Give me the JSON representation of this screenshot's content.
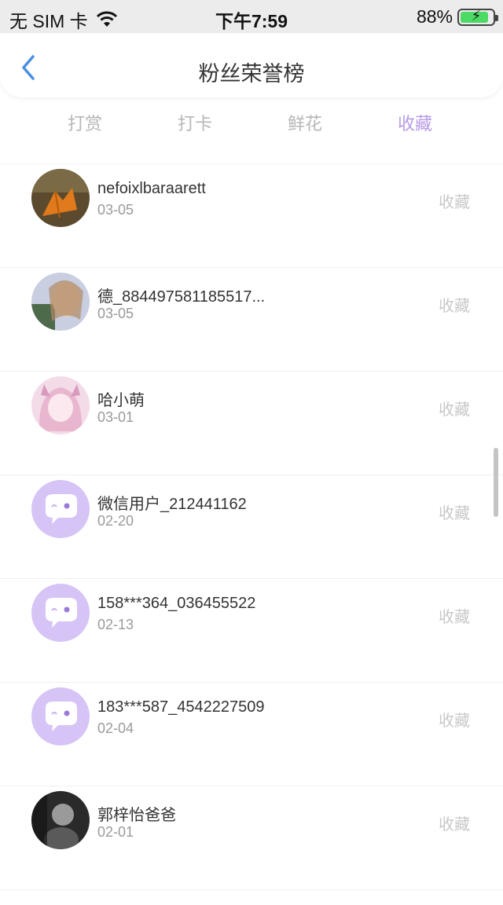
{
  "status_bar": {
    "carrier": "无 SIM 卡",
    "time": "下午7:59",
    "battery_percent": "88%",
    "battery_level": 0.88
  },
  "nav": {
    "title": "粉丝荣誉榜"
  },
  "tabs": [
    {
      "label": "打赏",
      "active": false
    },
    {
      "label": "打卡",
      "active": false
    },
    {
      "label": "鲜花",
      "active": false
    },
    {
      "label": "收藏",
      "active": true
    }
  ],
  "rows": [
    {
      "name": "nefoixlbaraarett",
      "date": "03-05",
      "action": "收藏",
      "avatar": "photo-leaf"
    },
    {
      "name": "德_884497581185517...",
      "date": "03-05",
      "action": "收藏",
      "avatar": "photo-girl"
    },
    {
      "name": "哈小萌",
      "date": "03-01",
      "action": "收藏",
      "avatar": "photo-anime"
    },
    {
      "name": "微信用户_212441162",
      "date": "02-20",
      "action": "收藏",
      "avatar": "default-chat-icon"
    },
    {
      "name": "158***364_036455522",
      "date": "02-13",
      "action": "收藏",
      "avatar": "default-chat-icon"
    },
    {
      "name": "183***587_4542227509",
      "date": "02-04",
      "action": "收藏",
      "avatar": "default-chat-icon"
    },
    {
      "name": "郭梓怡爸爸",
      "date": "02-01",
      "action": "收藏",
      "avatar": "photo-dark"
    }
  ],
  "colors": {
    "accent": "#b79be8",
    "default_avatar_bg": "#d6c4f6",
    "inactive_tab": "#b7b7b7"
  }
}
